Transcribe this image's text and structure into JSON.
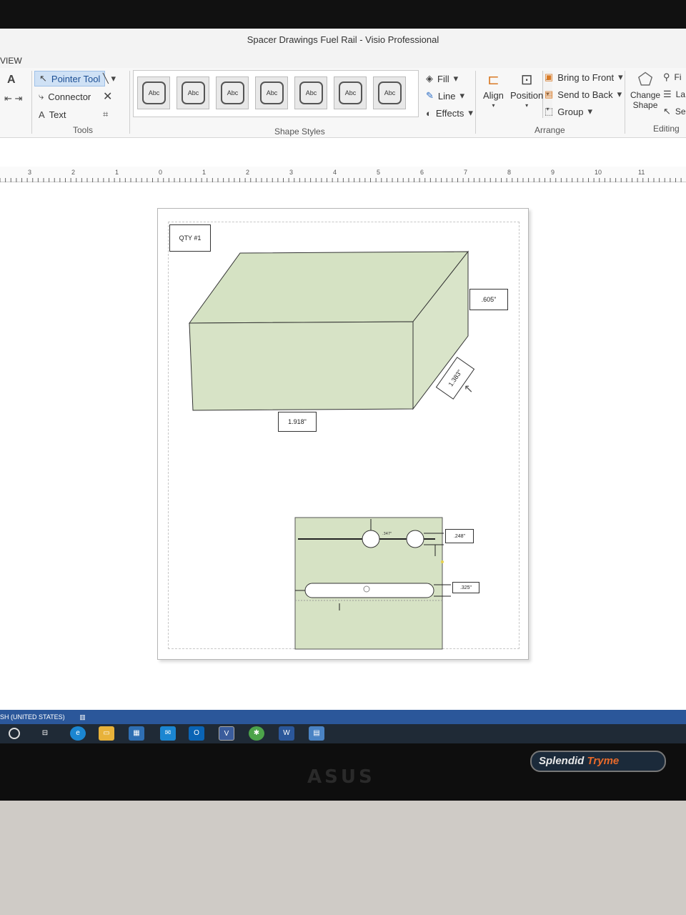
{
  "window": {
    "title": "Spacer Drawings Fuel Rail - Visio Professional",
    "tab_visible": "VIEW"
  },
  "ribbon": {
    "tools": {
      "pointer": "Pointer Tool",
      "connector": "Connector",
      "text": "Text",
      "group_label": "Tools"
    },
    "shape_styles": {
      "swatch_label": "Abc",
      "count": 7,
      "group_label": "Shape Styles",
      "fill": "Fill",
      "line": "Line",
      "effects": "Effects"
    },
    "arrange": {
      "align": "Align",
      "position": "Position",
      "bring_to_front": "Bring to Front",
      "send_to_back": "Send to Back",
      "group": "Group",
      "group_label": "Arrange"
    },
    "editing": {
      "change_shape_1": "Change",
      "change_shape_2": "Shape",
      "group_label": "Editing",
      "find_partial": "Fi",
      "layers_partial": "La",
      "select_partial": "Sel"
    }
  },
  "ruler": {
    "labels": [
      "3",
      "2",
      "1",
      "0",
      "1",
      "2",
      "3",
      "4",
      "5",
      "6",
      "7",
      "8",
      "9",
      "10",
      "11"
    ]
  },
  "drawing": {
    "qty_label": "QTY #1",
    "dim_height": ".605\"",
    "dim_depth": "1.383\"",
    "dim_width": "1.918\"",
    "dim_hole": ".248\"",
    "dim_slot": ".325\"",
    "small_dim_a": ".347\"",
    "fill_color": "#d6e2c4"
  },
  "statusbar": {
    "language": "SH (UNITED STATES)"
  },
  "monitor": {
    "brand": "ASUS",
    "badge_1": "Splendid",
    "badge_2": "Tryme"
  }
}
